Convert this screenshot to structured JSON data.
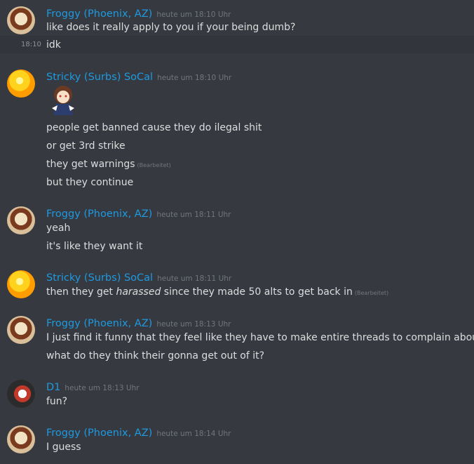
{
  "messages": [
    {
      "author": "Froggy (Phoenix, AZ)",
      "timestamp": "heute um 18:10 Uhr",
      "lines": [
        "like does it really apply to you if your being dumb?"
      ],
      "followup": {
        "timestamp": "18:10",
        "text": "idk"
      }
    },
    {
      "author": "Stricky (Surbs) SoCal",
      "timestamp": "heute um 18:10 Uhr",
      "lines": [
        "people get banned cause they do ilegal shit",
        "or get 3rd strike",
        "they get warnings",
        "but they continue"
      ],
      "edited_label": "(Bearbeitet)"
    },
    {
      "author": "Froggy (Phoenix, AZ)",
      "timestamp": "heute um 18:11 Uhr",
      "lines": [
        "yeah",
        "it's like they want it"
      ]
    },
    {
      "author": "Stricky (Surbs) SoCal",
      "timestamp": "heute um 18:11 Uhr",
      "line_prefix": "then they get ",
      "line_emph": "harassed",
      "line_suffix": " since they made 50 alts to get back in",
      "edited_label": "(Bearbeitet)"
    },
    {
      "author": "Froggy (Phoenix, AZ)",
      "timestamp": "heute um 18:13 Uhr",
      "lines": [
        "I just find it funny that they feel like they have to make entire threads to complain about it",
        "what do they think their gonna get out of it?"
      ]
    },
    {
      "author": "D1",
      "timestamp": "heute um 18:13 Uhr",
      "lines": [
        "fun?"
      ]
    },
    {
      "author": "Froggy (Phoenix, AZ)",
      "timestamp": "heute um 18:14 Uhr",
      "lines": [
        "I guess"
      ]
    }
  ],
  "colors": {
    "background": "#36393f",
    "username": "#1e9ae0",
    "timestamp": "#72767d",
    "text": "#dcddde"
  }
}
